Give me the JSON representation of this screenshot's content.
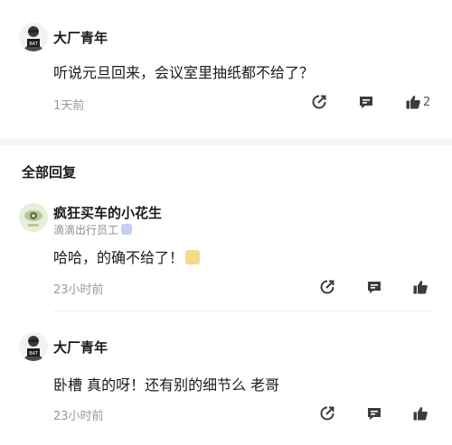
{
  "post": {
    "author": "大厂青年",
    "text": "听说元旦回来，会议室里抽纸都不给了？",
    "time": "1天前",
    "like_count": "2"
  },
  "section": {
    "title": "全部回复"
  },
  "replies": [
    {
      "author": "疯狂买车的小花生",
      "org": "滴滴出行员工",
      "text": "哈哈，的确不给了！",
      "time": "23小时前"
    },
    {
      "author": "大厂青年",
      "text": "卧槽 真的呀！还有别的细节么 老哥",
      "time": "23小时前"
    }
  ],
  "icons": {
    "share": "share-icon",
    "comment": "comment-icon",
    "like": "thumbs-up-icon",
    "verified": "verified-badge-icon",
    "emoji": "laughing-emoji-icon"
  },
  "colors": {
    "text": "#1a1a1a",
    "meta": "#999999",
    "icon": "#3c3c3c",
    "divider": "#f4f4f5"
  }
}
